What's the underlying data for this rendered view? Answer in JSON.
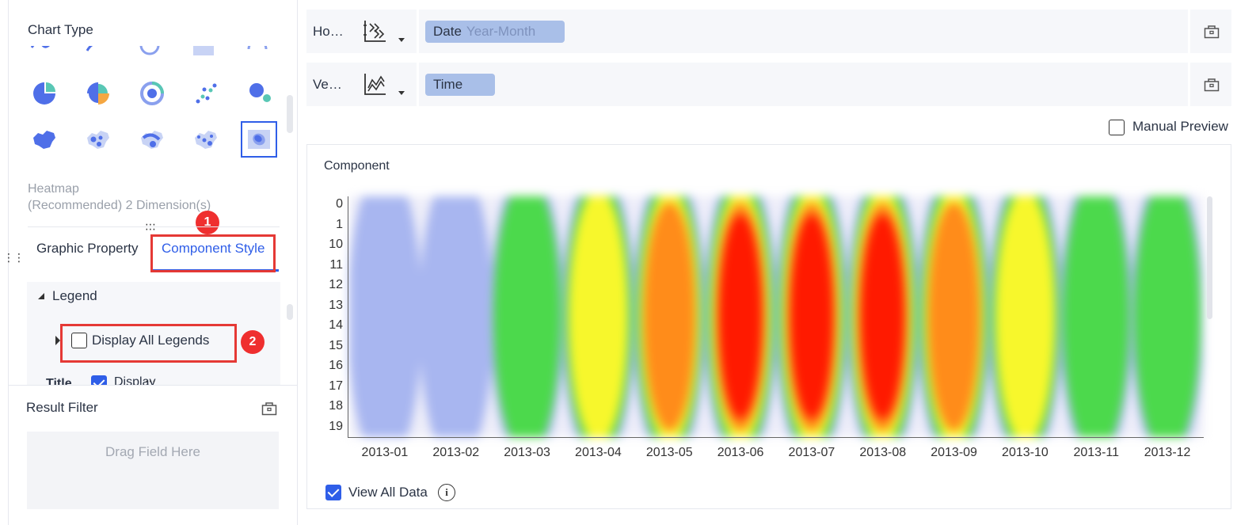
{
  "left_panel": {
    "chart_type_title": "Chart Type",
    "chart_types_row_maps": [
      "china-map-icon",
      "scatter-map-icon",
      "flow-map-icon",
      "dot-map-icon",
      "heatmap-icon"
    ],
    "caption_line1": "Heatmap",
    "caption_line2": "(Recommended) 2 Dimension(s)",
    "tabs": [
      {
        "label": "Graphic Property",
        "active": false
      },
      {
        "label": "Component Style",
        "active": true
      }
    ],
    "badges": [
      "1",
      "2"
    ],
    "legend_section": "Legend",
    "display_all_legends": "Display All Legends",
    "title_label": "Title",
    "display_label": "Display",
    "result_filter_title": "Result Filter",
    "drop_zone_text": "Drag Field Here"
  },
  "axes": {
    "horizontal": {
      "label": "Ho…",
      "field": "Date",
      "field_sub": "Year-Month"
    },
    "vertical": {
      "label": "Ve…",
      "field": "Time"
    }
  },
  "manual_preview": {
    "label": "Manual Preview",
    "checked": false
  },
  "component": {
    "title": "Component",
    "view_all_data": "View All Data",
    "info_glyph": "i"
  },
  "chart_data": {
    "type": "heatmap",
    "x_categories": [
      "2013-01",
      "2013-02",
      "2013-03",
      "2013-04",
      "2013-05",
      "2013-06",
      "2013-07",
      "2013-08",
      "2013-09",
      "2013-10",
      "2013-11",
      "2013-12"
    ],
    "y_categories": [
      "0",
      "1",
      "10",
      "11",
      "12",
      "13",
      "14",
      "15",
      "16",
      "17",
      "18",
      "19"
    ],
    "intensity_by_month": [
      0.05,
      0.05,
      0.35,
      0.6,
      0.85,
      0.9,
      0.95,
      0.9,
      0.75,
      0.6,
      0.45,
      0.45
    ],
    "color_scale": [
      "#eeeef9",
      "#a8b6f0",
      "#4cd94c",
      "#f7f72c",
      "#ff8c1a",
      "#ff1a00"
    ]
  }
}
